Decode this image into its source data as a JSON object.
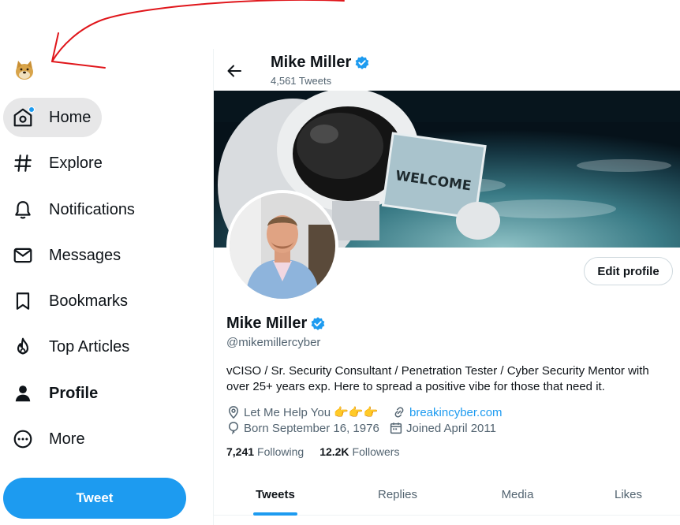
{
  "nav": {
    "items": [
      {
        "label": "Home",
        "icon": "home-icon",
        "active": true,
        "notification": true
      },
      {
        "label": "Explore",
        "icon": "hashtag-icon"
      },
      {
        "label": "Notifications",
        "icon": "bell-icon"
      },
      {
        "label": "Messages",
        "icon": "envelope-icon"
      },
      {
        "label": "Bookmarks",
        "icon": "bookmark-icon"
      },
      {
        "label": "Top Articles",
        "icon": "flame-icon"
      },
      {
        "label": "Profile",
        "icon": "person-icon",
        "bold": true
      },
      {
        "label": "More",
        "icon": "more-circle-icon"
      }
    ],
    "tweet_button": "Tweet"
  },
  "header": {
    "name": "Mike Miller",
    "tweet_count": "4,561 Tweets"
  },
  "banner": {
    "sign_text": "WELCOME"
  },
  "profile": {
    "edit_button": "Edit profile",
    "name": "Mike Miller",
    "handle": "@mikemillercyber",
    "bio": "vCISO / Sr. Security Consultant / Penetration Tester / Cyber Security Mentor with over 25+ years exp.  Here to spread a positive vibe for those that need it.",
    "location": "Let Me Help You 👉👉👉",
    "website": "breakincyber.com",
    "born": "Born September 16, 1976",
    "joined": "Joined April 2011",
    "following_count": "7,241",
    "following_label": "Following",
    "followers_count": "12.2K",
    "followers_label": "Followers"
  },
  "tabs": [
    {
      "label": "Tweets",
      "active": true
    },
    {
      "label": "Replies"
    },
    {
      "label": "Media"
    },
    {
      "label": "Likes"
    }
  ],
  "colors": {
    "accent": "#1d9bf0",
    "text": "#0f1419",
    "secondary": "#536471",
    "annotation": "#e0161b"
  }
}
